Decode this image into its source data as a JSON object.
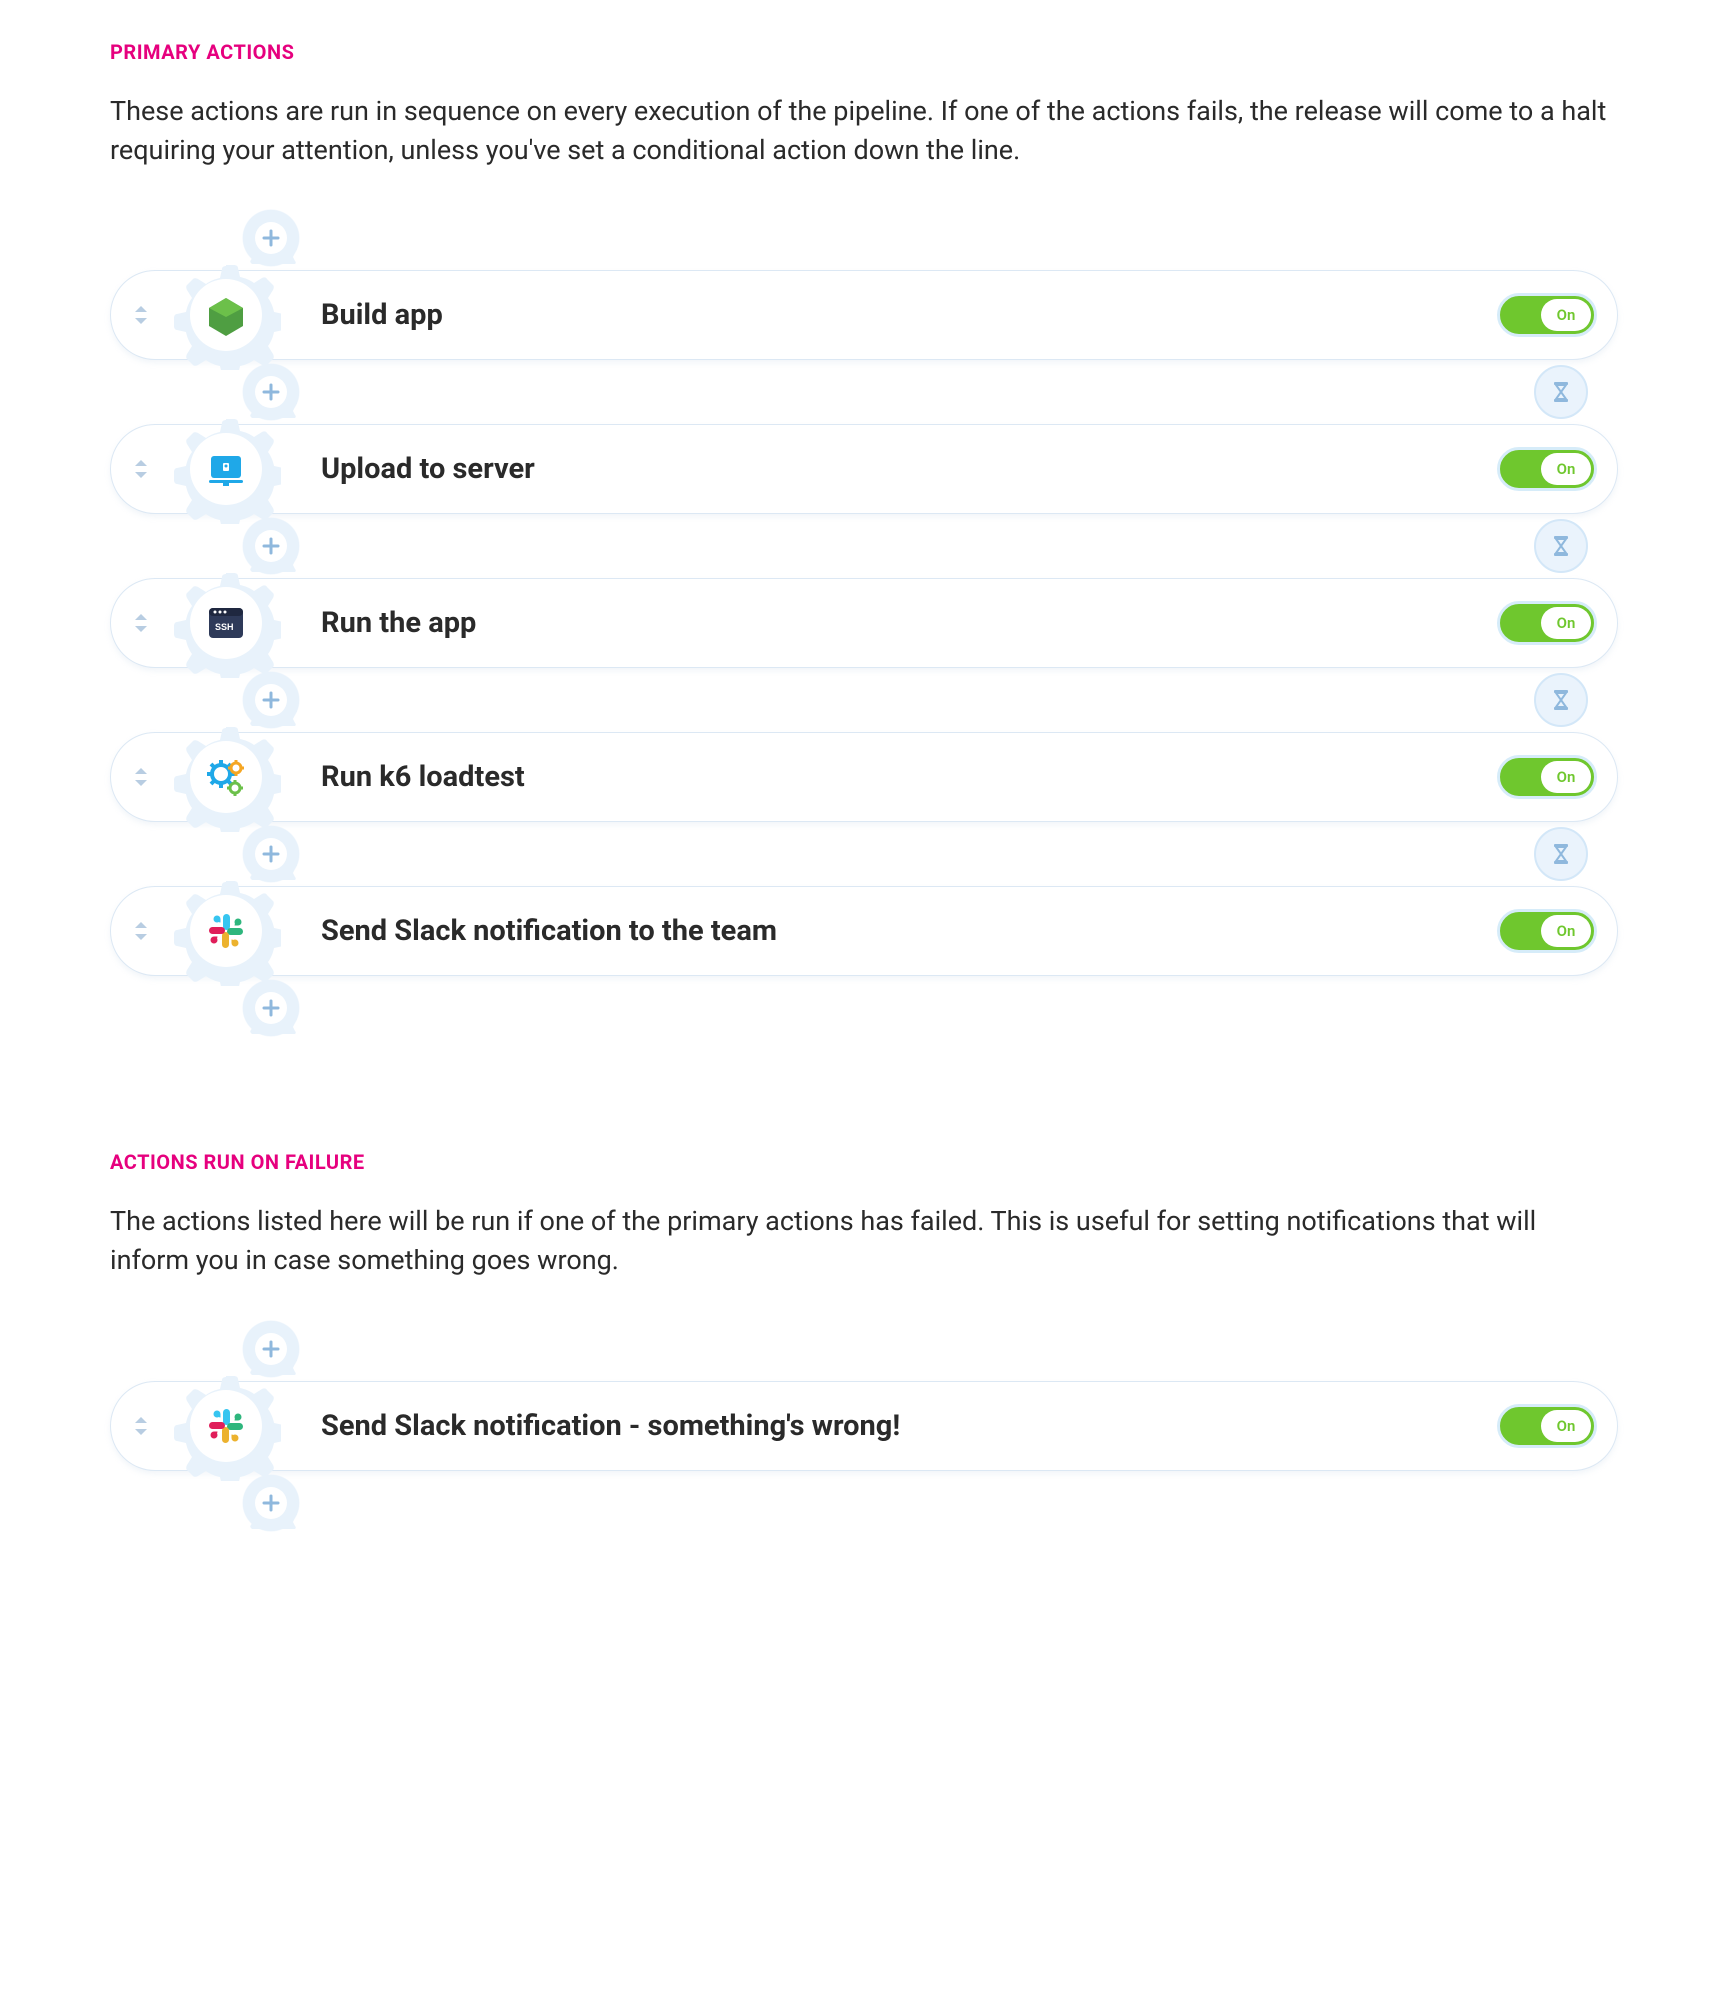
{
  "primary": {
    "title": "PRIMARY ACTIONS",
    "desc": "These actions are run in sequence on every execution of the pipeline. If one of the actions fails, the release will come to a halt requiring your attention, unless you've set a conditional action down the line.",
    "actions": [
      {
        "label": "Build app",
        "icon": "node",
        "toggle": "On"
      },
      {
        "label": "Upload to server",
        "icon": "server",
        "toggle": "On"
      },
      {
        "label": "Run the app",
        "icon": "ssh",
        "toggle": "On"
      },
      {
        "label": "Run k6 loadtest",
        "icon": "gears",
        "toggle": "On"
      },
      {
        "label": "Send Slack notification to the team",
        "icon": "slack",
        "toggle": "On"
      }
    ]
  },
  "failure": {
    "title": "ACTIONS RUN ON FAILURE",
    "desc": "The actions listed here will be run if one of the primary actions has failed. This is useful for setting notifications that will inform you in case something goes wrong.",
    "actions": [
      {
        "label": "Send Slack notification - something's wrong!",
        "icon": "slack",
        "toggle": "On"
      }
    ]
  }
}
